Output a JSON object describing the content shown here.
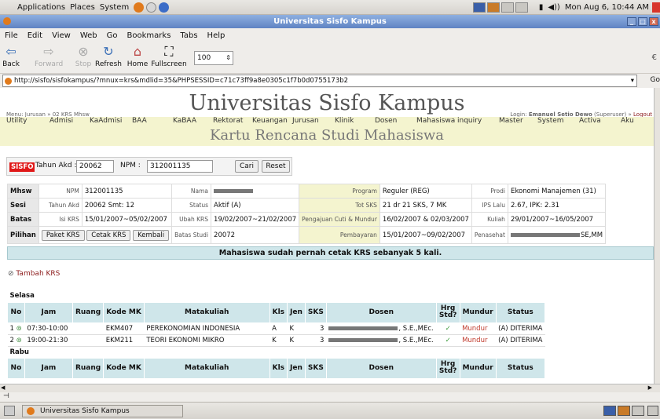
{
  "system_panel": {
    "menus": [
      "Applications",
      "Places",
      "System"
    ],
    "clock": "Mon Aug 6, 10:44 AM"
  },
  "window": {
    "title": "Universitas Sisfo Kampus"
  },
  "menubar": [
    "File",
    "Edit",
    "View",
    "Web",
    "Go",
    "Bookmarks",
    "Tabs",
    "Help"
  ],
  "toolbar": {
    "back": "Back",
    "forward": "Forward",
    "stop": "Stop",
    "refresh": "Refresh",
    "home": "Home",
    "fullscreen": "Fullscreen",
    "zoom": "100"
  },
  "address": {
    "url": "http://sisfo/sisfokampus/?mnux=krs&mdlid=35&PHPSESSID=c71c73ff9a8e0305c1f7b0d0755173b2",
    "go": "Go"
  },
  "page": {
    "menu_path": "Menu: Jurusan » 02 KRS Mhsw",
    "site_title": "Universitas Sisfo Kampus",
    "login_prefix": "Login:",
    "login_user": "Emanuel Setio Dewo",
    "login_role": "(Superuser) »",
    "logout": "Logout",
    "nav": [
      "Utility",
      "Admisi",
      "KaAdmisi",
      "BAA",
      "KaBAA",
      "Rektorat",
      "Keuangan",
      "Jurusan",
      "Klinik",
      "Dosen",
      "Mahasiswa",
      "inquiry",
      "Master",
      "System",
      "Activa",
      "Aku"
    ],
    "page_title": "Kartu Rencana Studi Mahasiswa"
  },
  "form": {
    "badge": "SISFO",
    "tahun_label": "Tahun Akd :",
    "tahun_value": "20062",
    "npm_label": "NPM :",
    "npm_value": "312001135",
    "cari": "Cari",
    "reset": "Reset"
  },
  "info": {
    "mhsw": "Mhsw",
    "sesi": "Sesi",
    "batas": "Batas",
    "pilihan": "Pilihan",
    "npm_k": "NPM",
    "npm_v": "312001135",
    "nama_k": "Nama",
    "program_k": "Program",
    "program_v": "Reguler (REG)",
    "prodi_k": "Prodi",
    "prodi_v": "Ekonomi Manajemen (31)",
    "tahun_k": "Tahun Akd",
    "tahun_v": "20062 Smt: 12",
    "status_k": "Status",
    "status_v": "Aktif (A)",
    "totsks_k": "Tot SKS",
    "totsks_v": "21 dr 21 SKS, 7 MK",
    "ips_k": "IPS Lalu",
    "ips_v": "2.67, IPK: 2.31",
    "isikrs_k": "Isi KRS",
    "isikrs_v": "15/01/2007~05/02/2007",
    "ubah_k": "Ubah KRS",
    "ubah_v": "19/02/2007~21/02/2007",
    "cuti_k": "Pengajuan Cuti & Mundur",
    "cuti_v": "16/02/2007 & 02/03/2007",
    "kuliah_k": "Kuliah",
    "kuliah_v": "29/01/2007~16/05/2007",
    "paket": "Paket KRS",
    "cetak": "Cetak KRS",
    "kembali": "Kembali",
    "batasstudi_k": "Batas Studi",
    "batasstudi_v": "20072",
    "bayar_k": "Pembayaran",
    "bayar_v": "15/01/2007~09/02/2007",
    "penasehat_k": "Penasehat",
    "penasehat_v": "SE,MM"
  },
  "notice": "Mahasiswa sudah pernah cetak KRS sebanyak 5 kali.",
  "tambah": "Tambah KRS",
  "schedule": {
    "headers": [
      "No",
      "Jam",
      "Ruang",
      "Kode MK",
      "Matakuliah",
      "Kls",
      "Jen",
      "SKS",
      "Dosen",
      "Hrg Std?",
      "Mundur",
      "Status"
    ],
    "days": [
      {
        "name": "Selasa",
        "rows": [
          {
            "no": "1",
            "jam": "07:30-10:00",
            "ruang": "",
            "kode": "EKM407",
            "mk": "PEREKONOMIAN INDONESIA",
            "kls": "A",
            "jen": "K",
            "sks": "3",
            "dosen": ", S.E.,MEc.",
            "hrg": "✓",
            "mundur": "Mundur",
            "status": "(A) DITERIMA"
          },
          {
            "no": "2",
            "jam": "19:00-21:30",
            "ruang": "",
            "kode": "EKM211",
            "mk": "TEORI EKONOMI MIKRO",
            "kls": "K",
            "jen": "K",
            "sks": "3",
            "dosen": ", S.E.,MEc.",
            "hrg": "✓",
            "mundur": "Mundur",
            "status": "(A) DITERIMA"
          }
        ]
      },
      {
        "name": "Rabu",
        "rows": []
      }
    ]
  },
  "taskbar": {
    "task": "Universitas Sisfo Kampus"
  },
  "colors": {
    "accent": "#f4f4cf",
    "header_blue": "#cfe6ea",
    "link_red": "#8b1a1a",
    "badge": "#e01818"
  }
}
